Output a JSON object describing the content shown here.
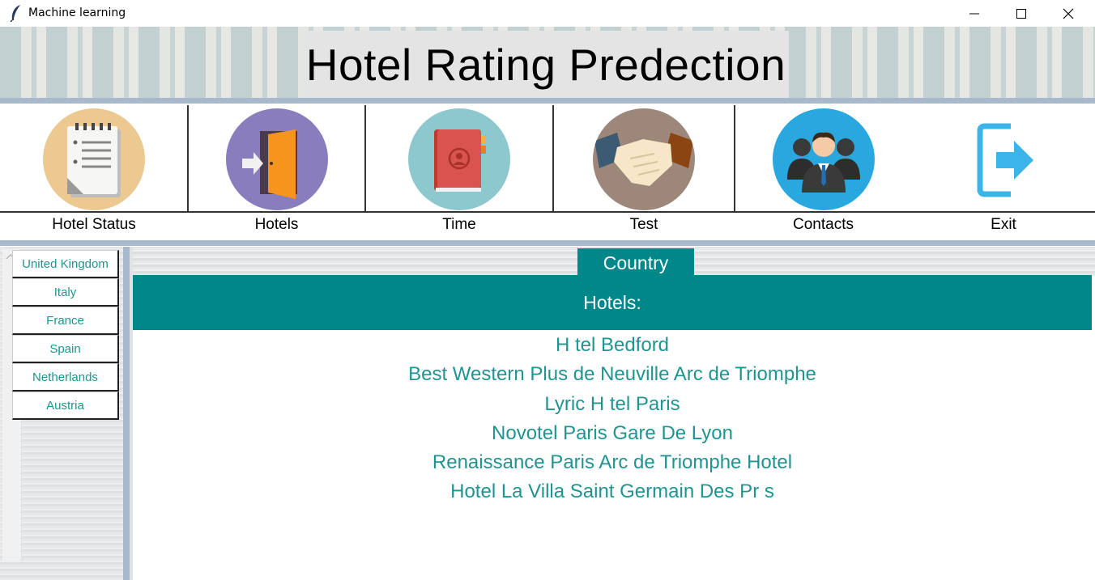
{
  "window": {
    "title": "Machine learning"
  },
  "banner": {
    "title": "Hotel Rating Predection"
  },
  "toolbar": {
    "items": [
      {
        "label": "Hotel Status",
        "icon": "notepad-icon",
        "color": "#ecc990"
      },
      {
        "label": "Hotels",
        "icon": "door-enter-icon",
        "color": "#8a7dbd"
      },
      {
        "label": "Time",
        "icon": "address-book-icon",
        "color": "#8ec8cf"
      },
      {
        "label": "Test",
        "icon": "handshake-icon",
        "color": "#9c877a"
      },
      {
        "label": "Contacts",
        "icon": "people-icon",
        "color": "#29a8e0"
      },
      {
        "label": "Exit",
        "icon": "exit-icon",
        "color": "#3bb4ea"
      }
    ]
  },
  "countries": [
    "United Kingdom",
    "Italy",
    "France",
    "Spain",
    "Netherlands",
    "Austria"
  ],
  "main": {
    "tab_label": "Country",
    "header": "Hotels:",
    "hotels": [
      "H tel Bedford",
      "Best Western Plus de Neuville Arc de Triomphe",
      "Lyric H tel Paris",
      "Novotel Paris Gare De Lyon",
      "Renaissance Paris Arc de Triomphe Hotel",
      "Hotel La Villa Saint Germain Des Pr s"
    ]
  },
  "colors": {
    "accent": "#00878a",
    "link_text": "#1f9490",
    "divider": "#a8b8cd"
  }
}
